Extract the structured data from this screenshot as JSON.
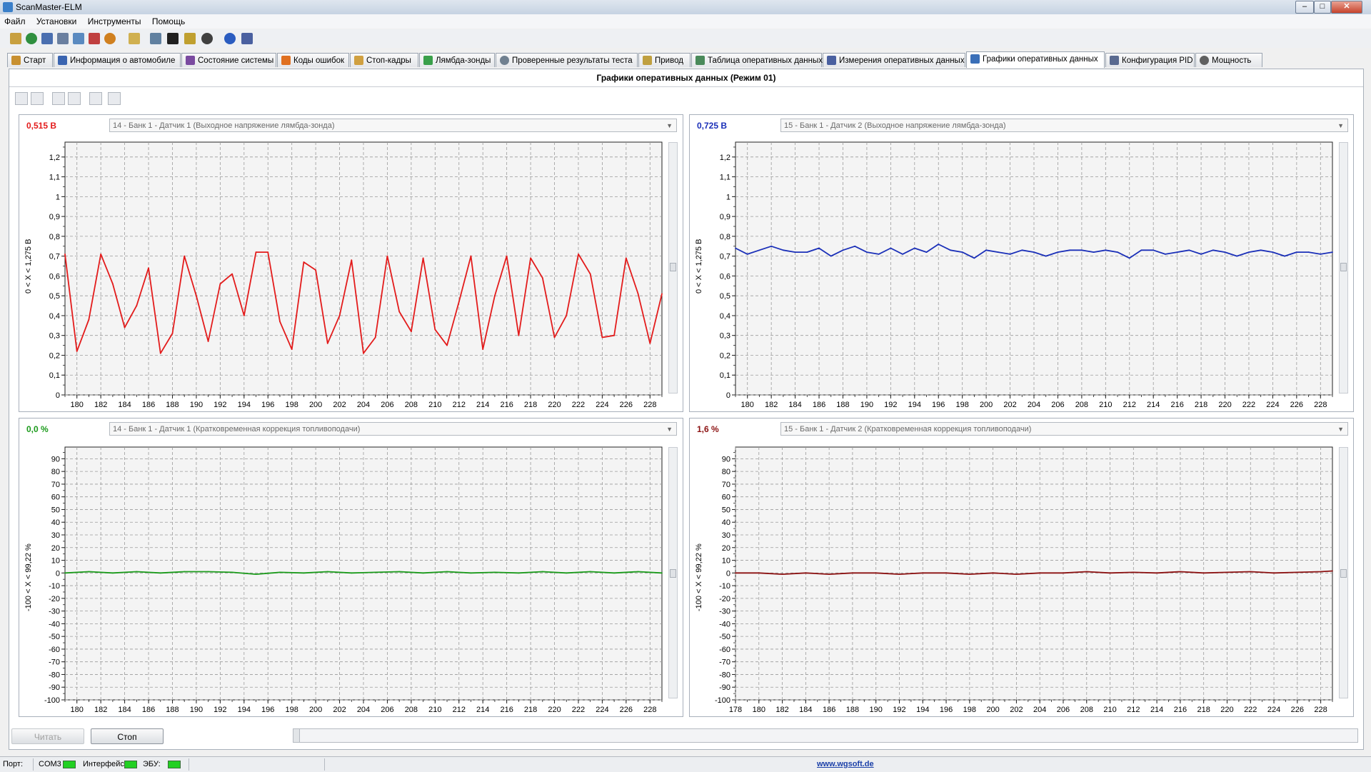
{
  "window": {
    "title": "ScanMaster-ELM"
  },
  "menu": {
    "items": [
      "Файл",
      "Установки",
      "Инструменты",
      "Помощь"
    ]
  },
  "tabs": [
    {
      "label": "Старт",
      "icon": "start-icon"
    },
    {
      "label": "Информация о автомобиле",
      "icon": "info-icon"
    },
    {
      "label": "Состояние системы",
      "icon": "system-status-icon"
    },
    {
      "label": "Коды ошибок",
      "icon": "warning-icon"
    },
    {
      "label": "Стоп-кадры",
      "icon": "freeze-frame-icon"
    },
    {
      "label": "Лямбда-зонды",
      "icon": "o2-sensor-icon"
    },
    {
      "label": "Проверенные результаты теста",
      "icon": "gear-icon"
    },
    {
      "label": "Привод",
      "icon": "drive-icon"
    },
    {
      "label": "Таблица оперативных данных",
      "icon": "table-icon"
    },
    {
      "label": "Измерения оперативных данных",
      "icon": "measure-icon"
    },
    {
      "label": "Графики оперативных данных",
      "icon": "chart-icon",
      "active": true
    },
    {
      "label": "Конфигурация PID",
      "icon": "config-icon"
    },
    {
      "label": "Мощность",
      "icon": "power-icon"
    }
  ],
  "panel": {
    "title": "Графики оперативных данных (Режим 01)"
  },
  "colors": {
    "red": "#e31b1b",
    "blue": "#1a2fb8",
    "green": "#1a9a1a",
    "maroon": "#8b1010"
  },
  "charts": [
    {
      "value": "0,515 В",
      "value_color": "#e31b1b",
      "select": "14 - Банк 1 - Датчик 1 (Выходное напряжение лямбда-зонда)",
      "range_label": "0  < X <  1,275 В",
      "line_color": "#e31b1b",
      "yticks": [
        "1,2",
        "1,1",
        "1",
        "0,9",
        "0,8",
        "0,7",
        "0,6",
        "0,5",
        "0,4",
        "0,3",
        "0,2",
        "0,1",
        "0"
      ],
      "xticks": [
        "180",
        "182",
        "184",
        "186",
        "188",
        "190",
        "192",
        "194",
        "196",
        "198",
        "200",
        "202",
        "204",
        "206",
        "208",
        "210",
        "212",
        "214",
        "216",
        "218",
        "220",
        "222",
        "224",
        "226",
        "228"
      ]
    },
    {
      "value": "0,725 В",
      "value_color": "#1a2fb8",
      "select": "15 - Банк 1 - Датчик 2 (Выходное напряжение лямбда-зонда)",
      "range_label": "0  < X <  1,275 В",
      "line_color": "#1a2fb8",
      "yticks": [
        "1,2",
        "1,1",
        "1",
        "0,9",
        "0,8",
        "0,7",
        "0,6",
        "0,5",
        "0,4",
        "0,3",
        "0,2",
        "0,1",
        "0"
      ],
      "xticks": [
        "180",
        "182",
        "184",
        "186",
        "188",
        "190",
        "192",
        "194",
        "196",
        "198",
        "200",
        "202",
        "204",
        "206",
        "208",
        "210",
        "212",
        "214",
        "216",
        "218",
        "220",
        "222",
        "224",
        "226",
        "228"
      ]
    },
    {
      "value": "0,0 %",
      "value_color": "#1a9a1a",
      "select": "14 - Банк 1 - Датчик 1 (Кратковременная коррекция топливоподачи)",
      "range_label": "-100  < X <  99,22 %",
      "line_color": "#1a9a1a",
      "yticks": [
        "90",
        "80",
        "70",
        "60",
        "50",
        "40",
        "30",
        "20",
        "10",
        "0",
        "-10",
        "-20",
        "-30",
        "-40",
        "-50",
        "-60",
        "-70",
        "-80",
        "-90",
        "-100"
      ],
      "xticks": [
        "180",
        "182",
        "184",
        "186",
        "188",
        "190",
        "192",
        "194",
        "196",
        "198",
        "200",
        "202",
        "204",
        "206",
        "208",
        "210",
        "212",
        "214",
        "216",
        "218",
        "220",
        "222",
        "224",
        "226",
        "228"
      ]
    },
    {
      "value": "1,6 %",
      "value_color": "#8b1010",
      "select": "15 - Банк 1 - Датчик 2 (Кратковременная коррекция топливоподачи)",
      "range_label": "-100  < X <  99,22 %",
      "line_color": "#8b1010",
      "yticks": [
        "90",
        "80",
        "70",
        "60",
        "50",
        "40",
        "30",
        "20",
        "10",
        "0",
        "-10",
        "-20",
        "-30",
        "-40",
        "-50",
        "-60",
        "-70",
        "-80",
        "-90",
        "-100"
      ],
      "xticks": [
        "178",
        "180",
        "182",
        "184",
        "186",
        "188",
        "190",
        "192",
        "194",
        "196",
        "198",
        "200",
        "202",
        "204",
        "206",
        "208",
        "210",
        "212",
        "214",
        "216",
        "218",
        "220",
        "222",
        "224",
        "226",
        "228"
      ]
    }
  ],
  "chart_data": [
    {
      "type": "line",
      "xlim": [
        179,
        229
      ],
      "ylim": [
        0,
        1.275
      ],
      "x": [
        179,
        180,
        181,
        182,
        183,
        184,
        185,
        186,
        187,
        188,
        189,
        190,
        191,
        192,
        193,
        194,
        195,
        196,
        197,
        198,
        199,
        200,
        201,
        202,
        203,
        204,
        205,
        206,
        207,
        208,
        209,
        210,
        211,
        212,
        213,
        214,
        215,
        216,
        217,
        218,
        219,
        220,
        221,
        222,
        223,
        224,
        225,
        226,
        227,
        228,
        229
      ],
      "series": [
        {
          "values": [
            0.71,
            0.22,
            0.38,
            0.71,
            0.56,
            0.34,
            0.45,
            0.64,
            0.21,
            0.31,
            0.7,
            0.5,
            0.27,
            0.56,
            0.61,
            0.4,
            0.72,
            0.72,
            0.37,
            0.23,
            0.67,
            0.63,
            0.26,
            0.4,
            0.68,
            0.21,
            0.29,
            0.7,
            0.42,
            0.32,
            0.69,
            0.33,
            0.25,
            0.47,
            0.7,
            0.23,
            0.5,
            0.7,
            0.3,
            0.69,
            0.59,
            0.29,
            0.4,
            0.71,
            0.61,
            0.29,
            0.3,
            0.69,
            0.51,
            0.26,
            0.51
          ]
        }
      ]
    },
    {
      "type": "line",
      "xlim": [
        179,
        229
      ],
      "ylim": [
        0,
        1.275
      ],
      "x": [
        179,
        180,
        181,
        182,
        183,
        184,
        185,
        186,
        187,
        188,
        189,
        190,
        191,
        192,
        193,
        194,
        195,
        196,
        197,
        198,
        199,
        200,
        201,
        202,
        203,
        204,
        205,
        206,
        207,
        208,
        209,
        210,
        211,
        212,
        213,
        214,
        215,
        216,
        217,
        218,
        219,
        220,
        221,
        222,
        223,
        224,
        225,
        226,
        227,
        228,
        229
      ],
      "series": [
        {
          "values": [
            0.74,
            0.71,
            0.73,
            0.75,
            0.73,
            0.72,
            0.72,
            0.74,
            0.7,
            0.73,
            0.75,
            0.72,
            0.71,
            0.74,
            0.71,
            0.74,
            0.72,
            0.76,
            0.73,
            0.72,
            0.69,
            0.73,
            0.72,
            0.71,
            0.73,
            0.72,
            0.7,
            0.72,
            0.73,
            0.73,
            0.72,
            0.73,
            0.72,
            0.69,
            0.73,
            0.73,
            0.71,
            0.72,
            0.73,
            0.71,
            0.73,
            0.72,
            0.7,
            0.72,
            0.73,
            0.72,
            0.7,
            0.72,
            0.72,
            0.71,
            0.72
          ]
        }
      ]
    },
    {
      "type": "line",
      "xlim": [
        179,
        229
      ],
      "ylim": [
        -100,
        99.22
      ],
      "x": [
        179,
        181,
        183,
        185,
        187,
        189,
        191,
        193,
        195,
        197,
        199,
        201,
        203,
        205,
        207,
        209,
        211,
        213,
        215,
        217,
        219,
        221,
        223,
        225,
        227,
        229
      ],
      "series": [
        {
          "values": [
            0.0,
            1.0,
            0.0,
            1.0,
            0.0,
            1.0,
            1.0,
            0.5,
            -1.0,
            0.5,
            0.0,
            1.0,
            0.0,
            0.5,
            1.0,
            0.0,
            1.0,
            0.0,
            0.5,
            0.0,
            1.0,
            0.0,
            1.0,
            0.0,
            1.0,
            0.0
          ]
        }
      ]
    },
    {
      "type": "line",
      "xlim": [
        178,
        229
      ],
      "ylim": [
        -100,
        99.22
      ],
      "x": [
        178,
        180,
        182,
        184,
        186,
        188,
        190,
        192,
        194,
        196,
        198,
        200,
        202,
        204,
        206,
        208,
        210,
        212,
        214,
        216,
        218,
        220,
        222,
        224,
        226,
        228,
        229
      ],
      "series": [
        {
          "values": [
            0.0,
            0.0,
            -1.0,
            0.0,
            -1.0,
            0.0,
            0.0,
            -1.0,
            0.0,
            0.0,
            -1.0,
            0.0,
            -1.0,
            0.0,
            0.0,
            1.0,
            0.0,
            0.5,
            0.0,
            1.0,
            0.0,
            0.5,
            1.0,
            0.0,
            0.5,
            1.0,
            1.6
          ]
        }
      ]
    }
  ],
  "buttons": {
    "read": "Читать",
    "stop": "Стоп"
  },
  "status": {
    "port_label": "Порт:",
    "port": "COM3",
    "interface_label": "Интерфейс:",
    "ecu_label": "ЭБУ:",
    "link": "www.wgsoft.de"
  }
}
